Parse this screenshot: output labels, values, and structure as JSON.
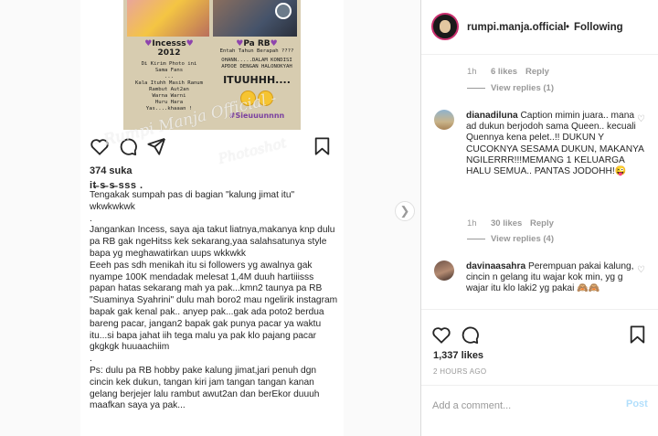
{
  "post_screenshot": {
    "image": {
      "left_heading": "Incesss",
      "left_year": "2012",
      "left_lines": [
        "Di Kirim Photo ini",
        "Sama Fans",
        "...",
        "Kala Ituhh Masih Ranum",
        "Rambut Aut2an",
        "Warna Warni",
        "Huru Hara",
        "Yas....khaaan !"
      ],
      "right_heading": "Pa RB",
      "right_lines": [
        "Entah Tahun Berapah ????",
        "OHANN.....DALAM KONDISI",
        "APDOE DENGAN HALONOKYAH"
      ],
      "right_big": "ITUUHHH....",
      "right_tag": "#Sieuuunnnn"
    },
    "watermark": "- Rumpi Manja Official -",
    "watermark2": "Photoshot",
    "likes": "374 suka",
    "username": "it̶ s̶ s̶ sss .",
    "caption": "Tengakak sumpah pas di bagian \"kalung jimat itu\" wkwkwkwk\n.\nJangankan Incess, saya aja takut liatnya,makanya knp dulu pa RB gak ngeHitss kek sekarang,yaa salahsatunya style bapa yg meghawatirkan uups wkkwkk\nEeeh pas sdh menikah itu si followers yg awalnya gak nyampe 100K mendadak melesat 1,4M duuh hartiiisss papan hatas sekarang mah ya pak...kmn2 taunya pa RB \"Suaminya Syahrini\" dulu mah boro2 mau ngelirik instagram bapak gak kenal pak.. anyep pak...gak ada poto2 berdua bareng pacar, jangan2 bapak gak punya pacar ya waktu itu...si bapa jahat iih tega malu ya pak klo pajang pacar gkgkgk huuaachiim\n.\nPs: dulu pa RB hobby pake kalung jimat,jari penuh dgn cincin kek dukun, tangan kiri jam tangan tangan kanan gelang berjejer lalu rambut awut2an dan berEkor duuuh maafkan saya ya pak..."
  },
  "header": {
    "username": "rumpi.manja.official",
    "separator": "•",
    "follow_status": "Following"
  },
  "top_meta": {
    "time": "1h",
    "likes": "6 likes",
    "reply": "Reply",
    "view_replies": "View replies (1)"
  },
  "comments": [
    {
      "username": "dianadiluna",
      "text": "Caption mimin juara.. mana ad dukun berjodoh sama Queen.. kecuali Quennya kena pelet..!! DUKUN Y CUCOKNYA SESAMA DUKUN, MAKANYA NGILERRR!!!MEMANG 1 KELUARGA HALU SEMUA.. PANTAS JODOHH!😜",
      "time": "1h",
      "likes": "30 likes",
      "reply": "Reply",
      "view_replies": "View replies (4)"
    },
    {
      "username": "davinaasahra",
      "text": "Perempuan pakai kalung, cincin n gelang itu wajar kok min, yg g wajar itu klo laki2 yg pakai 🙈🙈"
    }
  ],
  "footer": {
    "likes": "1,337 likes",
    "time": "2 HOURS AGO",
    "add_comment_placeholder": "Add a comment...",
    "post_label": "Post"
  },
  "icons": {
    "heart": "heart-icon",
    "comment": "comment-icon",
    "share": "share-icon",
    "bookmark": "bookmark-icon",
    "next": "chevron-right-icon"
  },
  "colors": {
    "accent": "#3897f0",
    "post_button_disabled": "#b2dffc",
    "meta_gray": "#999999",
    "text": "#262626"
  }
}
